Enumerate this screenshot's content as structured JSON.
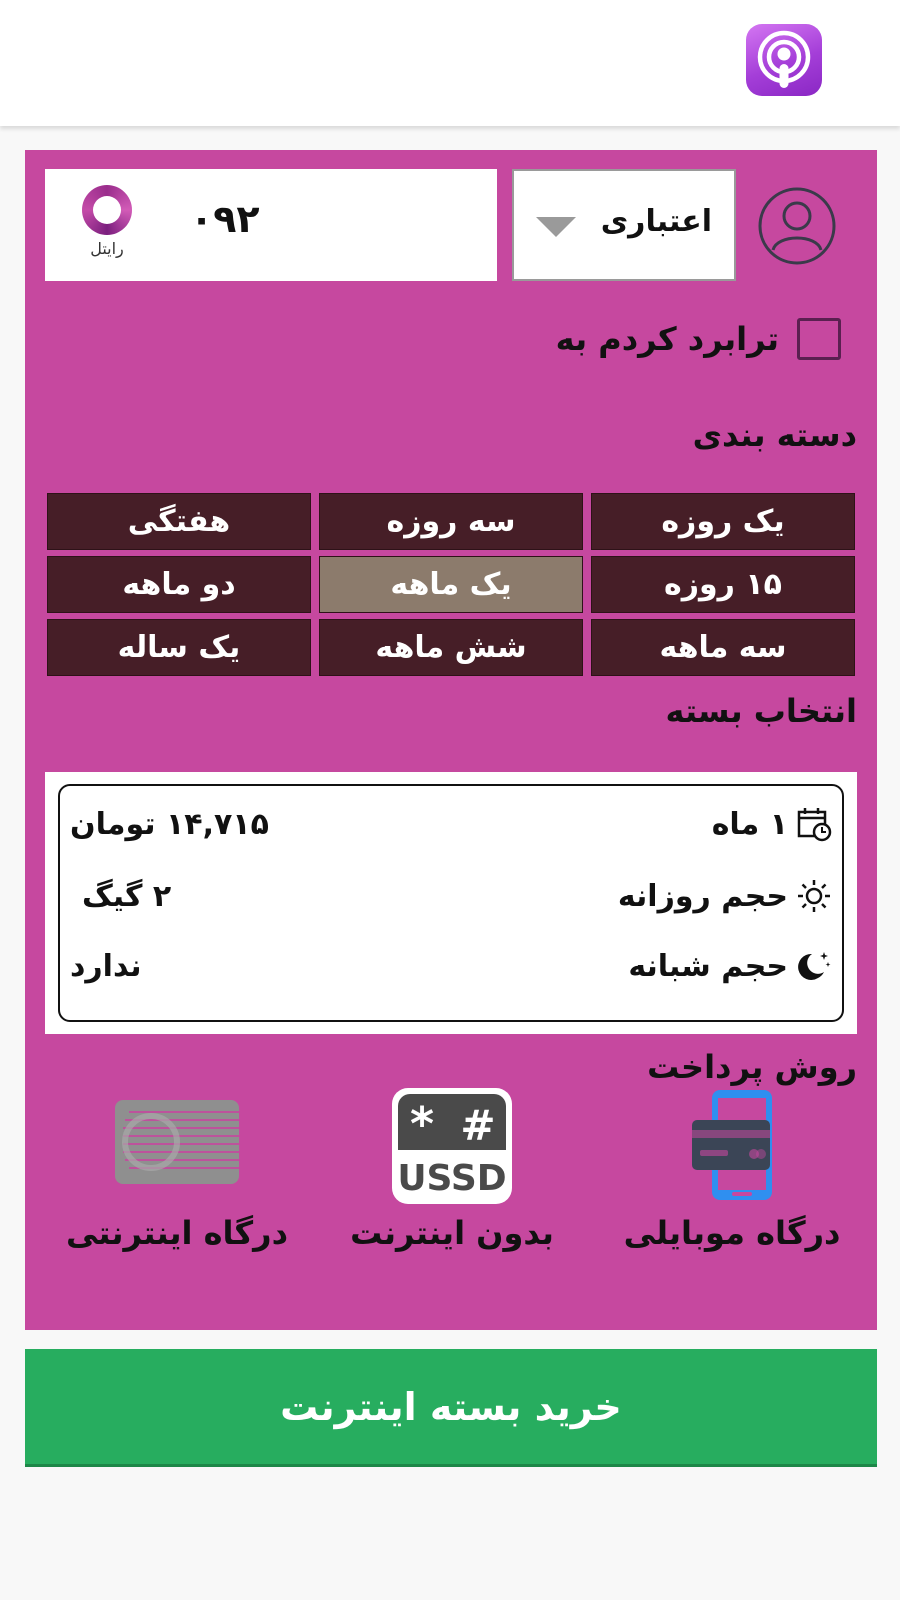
{
  "form": {
    "phone_number": "۰۹۲",
    "operator_name": "رایتل",
    "sim_type": "اعتباری",
    "transfer_checkbox_label": "ترابرد کردم به"
  },
  "categories": {
    "title": "دسته بندی",
    "items": [
      {
        "label": "یک روزه",
        "selected": false
      },
      {
        "label": "سه روزه",
        "selected": false
      },
      {
        "label": "هفتگی",
        "selected": false
      },
      {
        "label": "۱۵ روزه",
        "selected": false
      },
      {
        "label": "یک ماهه",
        "selected": true
      },
      {
        "label": "دو ماهه",
        "selected": false
      },
      {
        "label": "سه ماهه",
        "selected": false
      },
      {
        "label": "شش ماهه",
        "selected": false
      },
      {
        "label": "یک ساله",
        "selected": false
      }
    ]
  },
  "package": {
    "title": "انتخاب بسته",
    "duration": "۱ ماه",
    "price": "۱۴,۷۱۵ تومان",
    "daily_label": "حجم روزانه",
    "daily_value": "۲ گیگ",
    "night_label": "حجم شبانه",
    "night_value": "ندارد"
  },
  "payment": {
    "title": "روش پرداخت",
    "methods": [
      {
        "label": "درگاه موبایلی",
        "icon": "mobile-card-icon"
      },
      {
        "label": "بدون اینترنت",
        "icon": "ussd-icon",
        "icon_text": "USSD"
      },
      {
        "label": "درگاه اینترنتی",
        "icon": "internet-gateway-icon"
      }
    ]
  },
  "buy_button_label": "خرید بسته اینترنت",
  "colors": {
    "panel": "#c6489f",
    "category_button": "#461e27",
    "category_selected": "#8c7b6c",
    "buy_button": "#27ad5f"
  }
}
